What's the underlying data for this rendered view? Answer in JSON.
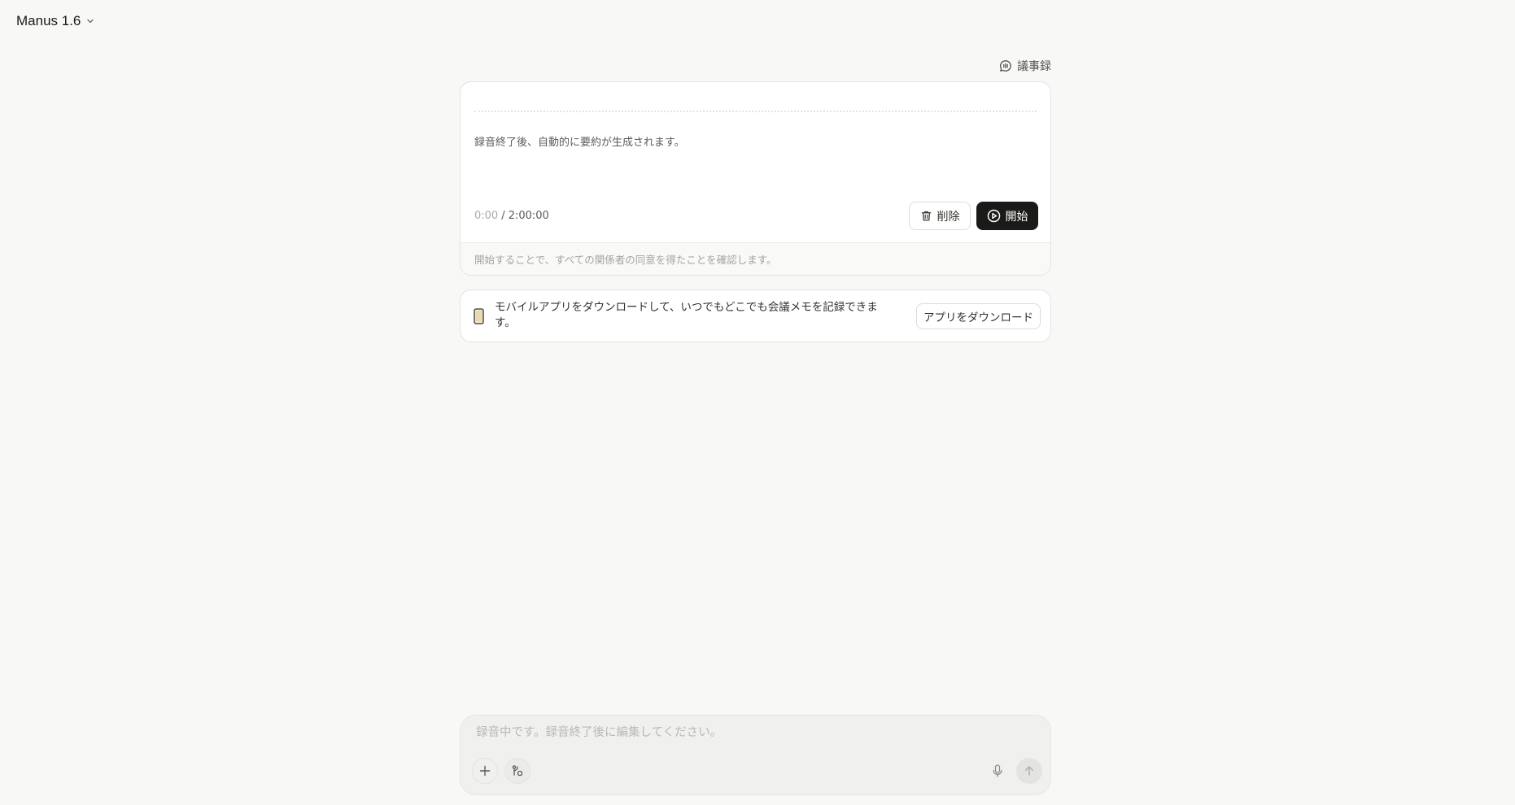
{
  "header": {
    "model_name": "Manus 1.6",
    "model_chevron_icon": "chevron-down-icon"
  },
  "minutes_link": {
    "label": "議事録",
    "icon": "meeting-bubble-icon"
  },
  "recording_card": {
    "note": "録音終了後、自動的に要約が生成されます。",
    "timer_current": "0:00",
    "timer_total": "/ 2:00:00",
    "delete_label": "削除",
    "delete_icon": "trash-icon",
    "start_label": "開始",
    "start_icon": "play-circle-icon",
    "consent_text": "開始することで、すべての関係者の同意を得たことを確認します。"
  },
  "app_banner": {
    "icon": "phone-icon",
    "text": "モバイルアプリをダウンロードして、いつでもどこでも会議メモを記録できます。",
    "download_label": "アプリをダウンロード"
  },
  "composer": {
    "placeholder": "録音中です。録音終了後に編集してください。",
    "value": "",
    "add_icon": "plus-icon",
    "tools_icon": "connector-icon",
    "mic_icon": "microphone-icon",
    "send_icon": "arrow-up-icon"
  },
  "colors": {
    "background": "#f8f8f7",
    "card": "#ffffff",
    "primary_button": "#1a1a19",
    "muted_text": "#a3a3a0"
  }
}
